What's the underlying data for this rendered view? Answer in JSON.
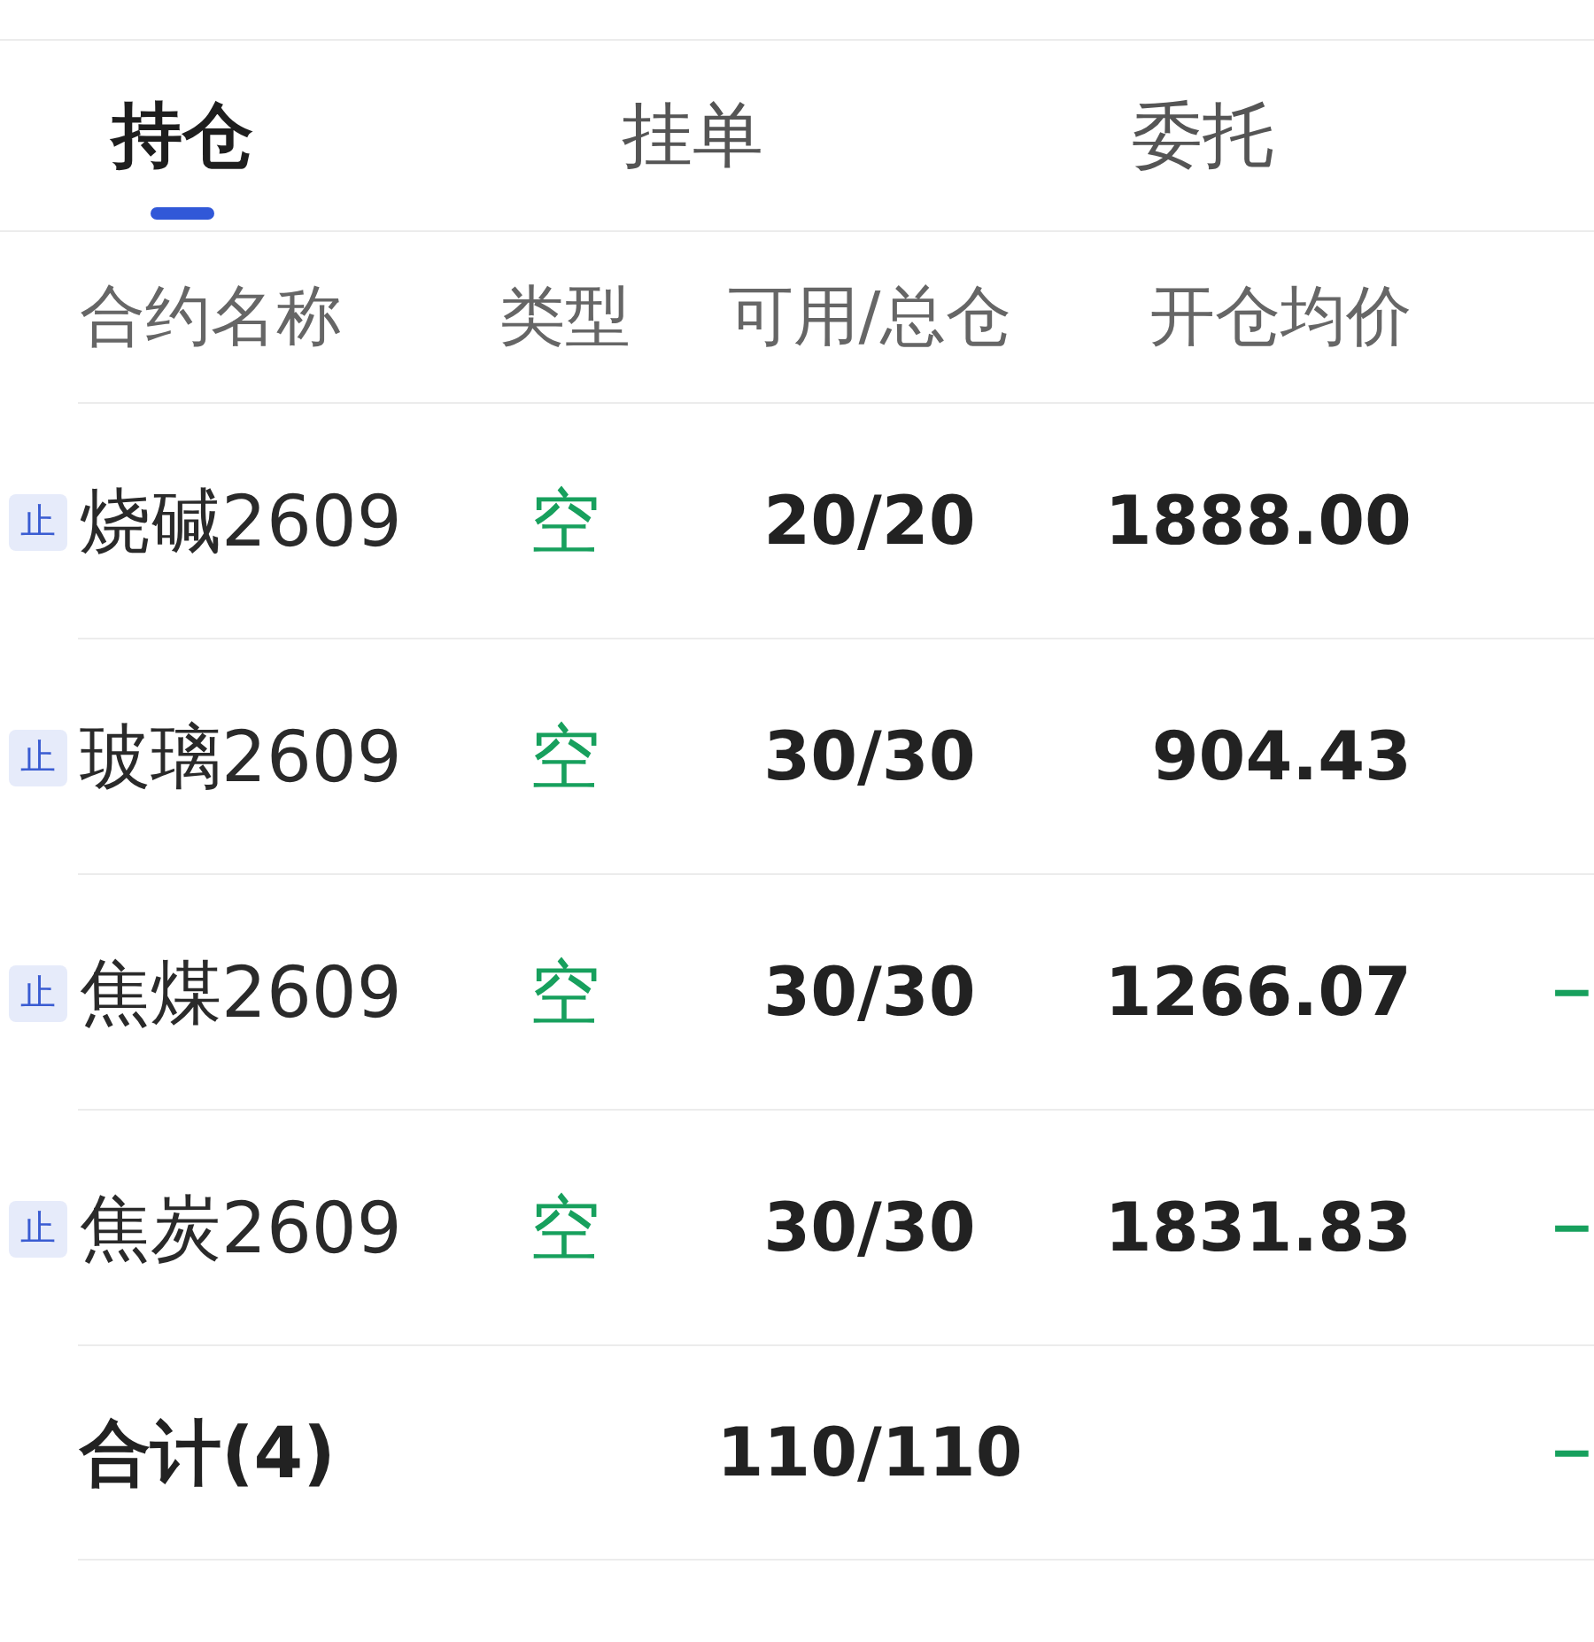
{
  "tabs": [
    {
      "label": "持仓",
      "selected": true
    },
    {
      "label": "挂单",
      "selected": false
    },
    {
      "label": "委托",
      "selected": false
    }
  ],
  "table": {
    "columns": [
      "合约名称",
      "类型",
      "可用/总仓",
      "开仓均价"
    ],
    "rows": [
      {
        "badge": "止",
        "name": "烧碱2609",
        "type": "空",
        "available_total": "20/20",
        "avg_open_price": "1888.00"
      },
      {
        "badge": "止",
        "name": "玻璃2609",
        "type": "空",
        "available_total": "30/30",
        "avg_open_price": "904.43"
      },
      {
        "badge": "止",
        "name": "焦煤2609",
        "type": "空",
        "available_total": "30/30",
        "avg_open_price": "1266.07",
        "column_5": "−"
      },
      {
        "badge": "止",
        "name": "焦炭2609",
        "type": "空",
        "available_total": "30/30",
        "avg_open_price": "1831.83",
        "column_5": "−"
      }
    ],
    "total": {
      "label": "合计(4)",
      "available_total": "110/110",
      "column_5": "−"
    }
  }
}
